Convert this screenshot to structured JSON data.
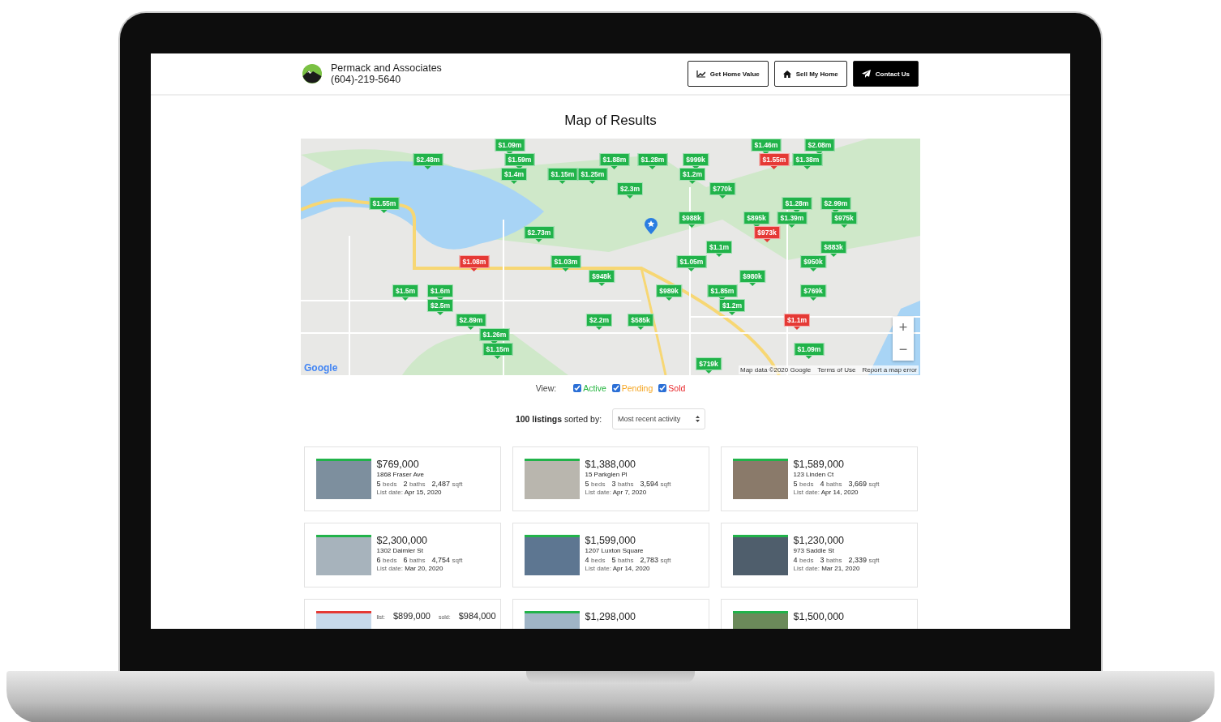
{
  "header": {
    "brand": {
      "name": "Permack and Associates",
      "phone": "(604)-219-5640"
    },
    "buttons": [
      {
        "label": "Get Home Value",
        "kind": "outline"
      },
      {
        "label": "Sell My Home",
        "kind": "outline"
      },
      {
        "label": "Contact Us",
        "kind": "filled"
      }
    ]
  },
  "title": "Map of Results",
  "map": {
    "pins": [
      {
        "label": "$1.09m",
        "kind": "active"
      },
      {
        "label": "$1.46m",
        "kind": "active"
      },
      {
        "label": "$2.08m",
        "kind": "active"
      },
      {
        "label": "$2.48m",
        "kind": "active"
      },
      {
        "label": "$1.59m",
        "kind": "active"
      },
      {
        "label": "$1.88m",
        "kind": "active"
      },
      {
        "label": "$1.28m",
        "kind": "active"
      },
      {
        "label": "$999k",
        "kind": "active"
      },
      {
        "label": "$1.55m",
        "kind": "sold"
      },
      {
        "label": "$1.38m",
        "kind": "active"
      },
      {
        "label": "$1.4m",
        "kind": "active"
      },
      {
        "label": "$1.15m",
        "kind": "active"
      },
      {
        "label": "$1.25m",
        "kind": "active"
      },
      {
        "label": "$1.2m",
        "kind": "active"
      },
      {
        "label": "$2.3m",
        "kind": "active"
      },
      {
        "label": "$770k",
        "kind": "active"
      },
      {
        "label": "$1.55m",
        "kind": "active"
      },
      {
        "label": "$1.28m",
        "kind": "active"
      },
      {
        "label": "$2.99m",
        "kind": "active"
      },
      {
        "label": "$988k",
        "kind": "active"
      },
      {
        "label": "$895k",
        "kind": "active"
      },
      {
        "label": "$1.39m",
        "kind": "active"
      },
      {
        "label": "$975k",
        "kind": "active"
      },
      {
        "label": "$2.73m",
        "kind": "active"
      },
      {
        "label": "$973k",
        "kind": "sold"
      },
      {
        "label": "$1.1m",
        "kind": "active"
      },
      {
        "label": "$883k",
        "kind": "active"
      },
      {
        "label": "$1.08m",
        "kind": "sold"
      },
      {
        "label": "$1.03m",
        "kind": "active"
      },
      {
        "label": "$1.05m",
        "kind": "active"
      },
      {
        "label": "$950k",
        "kind": "active"
      },
      {
        "label": "$948k",
        "kind": "active"
      },
      {
        "label": "$980k",
        "kind": "active"
      },
      {
        "label": "$1.5m",
        "kind": "active"
      },
      {
        "label": "$1.6m",
        "kind": "active"
      },
      {
        "label": "$989k",
        "kind": "active"
      },
      {
        "label": "$1.85m",
        "kind": "active"
      },
      {
        "label": "$769k",
        "kind": "active"
      },
      {
        "label": "$2.5m",
        "kind": "active"
      },
      {
        "label": "$1.2m",
        "kind": "active"
      },
      {
        "label": "$2.89m",
        "kind": "active"
      },
      {
        "label": "$2.2m",
        "kind": "active"
      },
      {
        "label": "$585k",
        "kind": "active"
      },
      {
        "label": "$1.1m",
        "kind": "sold"
      },
      {
        "label": "$1.26m",
        "kind": "active"
      },
      {
        "label": "$1.15m",
        "kind": "active"
      },
      {
        "label": "$1.09m",
        "kind": "active"
      },
      {
        "label": "$719k",
        "kind": "active"
      }
    ],
    "zoom_buttons": [
      "+",
      "−"
    ],
    "logo": "Google",
    "attribution": [
      "Map data ©2020 Google",
      "Terms of Use",
      "Report a map error"
    ]
  },
  "view": {
    "label": "View:",
    "filters": [
      {
        "label": "Active",
        "checked": true,
        "color": "#1fb33a"
      },
      {
        "label": "Pending",
        "checked": true,
        "color": "#f5a623"
      },
      {
        "label": "Sold",
        "checked": true,
        "color": "#e8262a"
      }
    ]
  },
  "sort": {
    "label": "**100 listings** sorted by:",
    "value": "Most recent activity"
  },
  "listings": [
    {
      "kind": "active",
      "price": "$769,000",
      "address": "1868 Fraser Ave",
      "stats": [
        {
          "value": "5",
          "unit": "beds"
        },
        {
          "value": "2",
          "unit": "baths"
        },
        {
          "value": "2,487",
          "unit": "sqft"
        }
      ],
      "date": {
        "label": "List date:",
        "value": "Apr 15, 2020"
      }
    },
    {
      "kind": "active",
      "price": "$1,388,000",
      "address": "15 Parkglen Pl",
      "stats": [
        {
          "value": "5",
          "unit": "beds"
        },
        {
          "value": "3",
          "unit": "baths"
        },
        {
          "value": "3,594",
          "unit": "sqft"
        }
      ],
      "date": {
        "label": "List date:",
        "value": "Apr 7, 2020"
      }
    },
    {
      "kind": "active",
      "price": "$1,589,000",
      "address": "123 Linden Ct",
      "stats": [
        {
          "value": "5",
          "unit": "beds"
        },
        {
          "value": "4",
          "unit": "baths"
        },
        {
          "value": "3,669",
          "unit": "sqft"
        }
      ],
      "date": {
        "label": "List date:",
        "value": "Apr 14, 2020"
      }
    },
    {
      "kind": "active",
      "price": "$2,300,000",
      "address": "1302 Daimler St",
      "stats": [
        {
          "value": "6",
          "unit": "beds"
        },
        {
          "value": "6",
          "unit": "baths"
        },
        {
          "value": "4,754",
          "unit": "sqft"
        }
      ],
      "date": {
        "label": "List date:",
        "value": "Mar 20, 2020"
      }
    },
    {
      "kind": "active",
      "price": "$1,599,000",
      "address": "1207 Luxton Square",
      "stats": [
        {
          "value": "4",
          "unit": "beds"
        },
        {
          "value": "5",
          "unit": "baths"
        },
        {
          "value": "2,783",
          "unit": "sqft"
        }
      ],
      "date": {
        "label": "List date:",
        "value": "Apr 14, 2020"
      }
    },
    {
      "kind": "active",
      "price": "$1,230,000",
      "address": "973 Saddle St",
      "stats": [
        {
          "value": "4",
          "unit": "beds"
        },
        {
          "value": "3",
          "unit": "baths"
        },
        {
          "value": "2,339",
          "unit": "sqft"
        }
      ],
      "date": {
        "label": "List date:",
        "value": "Mar 21, 2020"
      }
    },
    {
      "kind": "sold",
      "prices": [
        {
          "label": "list:",
          "value": "$899,000"
        },
        {
          "label": "sold:",
          "value": "$984,000"
        }
      ]
    },
    {
      "kind": "active",
      "price": "$1,298,000"
    },
    {
      "kind": "active",
      "price": "$1,500,000"
    }
  ]
}
